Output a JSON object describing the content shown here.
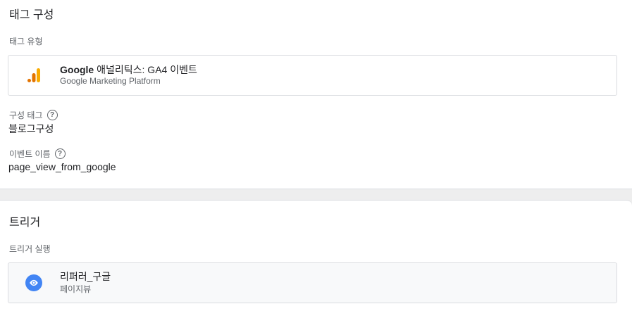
{
  "config": {
    "title": "태그 구성",
    "tag_type_label": "태그 유형",
    "tag_type": {
      "name_bold": "Google",
      "name_rest": " 애널리틱스: GA4 이벤트",
      "platform": "Google Marketing Platform",
      "icon": "google-analytics-icon"
    },
    "config_tag_label": "구성 태그",
    "config_tag_value": "블로그구성",
    "event_name_label": "이벤트 이름",
    "event_name_value": "page_view_from_google"
  },
  "trigger": {
    "title": "트리거",
    "firing_label": "트리거 실행",
    "item": {
      "name": "리퍼러_구글",
      "type": "페이지뷰",
      "icon": "eye-icon"
    }
  },
  "colors": {
    "ga_orange_dark": "#e37400",
    "ga_orange_light": "#f9ab00",
    "trigger_blue": "#4285f4"
  }
}
